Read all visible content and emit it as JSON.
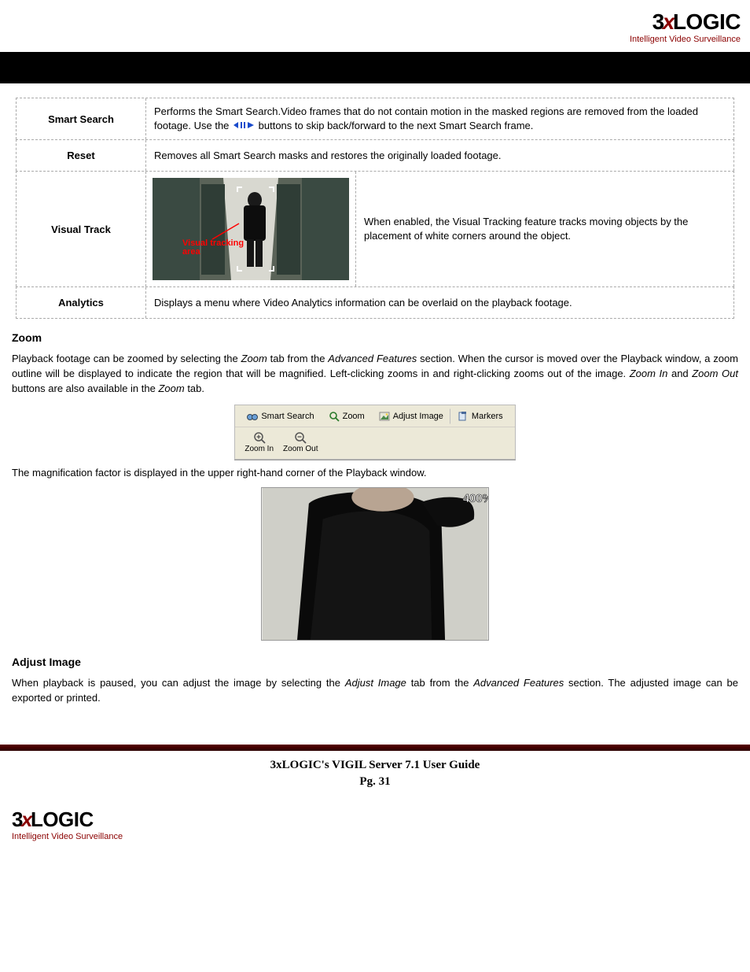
{
  "brand": {
    "logo": "3xLOGIC",
    "tagline": "Intelligent Video Surveillance"
  },
  "table": {
    "rows": [
      {
        "label": "Smart Search",
        "desc_before": "Performs the Smart Search.Video frames that do not contain motion in the masked regions are removed from the loaded footage. Use the ",
        "desc_after": " buttons to skip back/forward to the next Smart Search frame."
      },
      {
        "label": "Reset",
        "desc": "Removes all Smart Search masks and restores the originally loaded footage."
      },
      {
        "label": "Visual Track",
        "img_annotation": "Visual tracking area",
        "desc": "When enabled, the Visual Tracking feature tracks moving objects by the placement of white corners around the object."
      },
      {
        "label": "Analytics",
        "desc": "Displays a menu where Video Analytics information can be overlaid on the playback footage."
      }
    ]
  },
  "zoom": {
    "heading": "Zoom",
    "p1_parts": [
      "Playback footage can be zoomed by selecting the ",
      "Zoom",
      " tab from the ",
      "Advanced Features",
      " section. When the cursor is moved over the Playback window, a zoom outline will be displayed to indicate the region that will be magnified. Left-clicking zooms in and right-clicking zooms out of the image. ",
      "Zoom In",
      " and ",
      "Zoom Out",
      " buttons are also available in the ",
      "Zoom",
      " tab."
    ],
    "toolbar": {
      "tabs": [
        "Smart Search",
        "Zoom",
        "Adjust Image",
        "Markers"
      ],
      "buttons": [
        "Zoom In",
        "Zoom Out"
      ]
    },
    "p2": "The magnification factor is displayed in the upper right-hand corner of the Playback window.",
    "mag_label": "400%"
  },
  "adjust": {
    "heading": "Adjust Image",
    "p_parts": [
      "When playback is paused, you can adjust the image by selecting the ",
      "Adjust Image",
      " tab from the ",
      "Advanced Features",
      " section. The adjusted image can be exported or printed."
    ]
  },
  "footer": {
    "title": "3xLOGIC's VIGIL Server 7.1 User Guide",
    "page": "Pg. 31"
  }
}
